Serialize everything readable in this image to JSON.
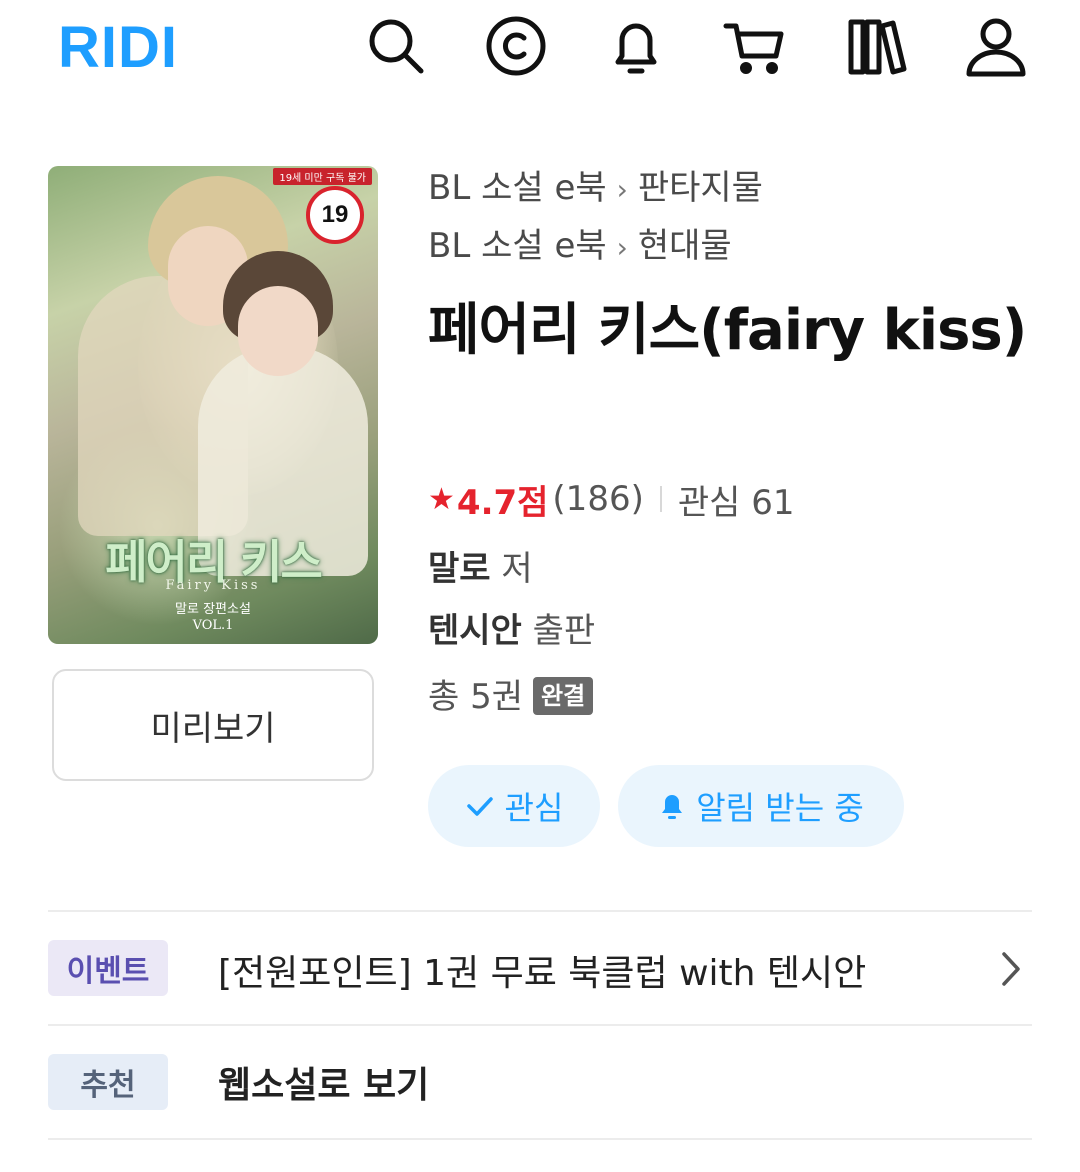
{
  "header": {
    "logo": "RIDI",
    "icons": [
      "search-icon",
      "cash-icon",
      "bell-icon",
      "cart-icon",
      "library-icon",
      "user-icon"
    ],
    "logo_color": "#1e9eff"
  },
  "book": {
    "cover": {
      "age_strip": "19세 미만 구독 불가",
      "age_badge": "19",
      "title": "페어리 키스",
      "title_en": "Fairy Kiss",
      "subtitle": "말로 장편소설",
      "volume": "VOL.1"
    },
    "preview_label": "미리보기",
    "categories": [
      {
        "main": "BL 소설 e북",
        "sub": "판타지물"
      },
      {
        "main": "BL 소설 e북",
        "sub": "현대물"
      }
    ],
    "title": "페어리 키스(fairy kiss)",
    "rating": {
      "score": "4.7점",
      "count": "(186)",
      "interest": "관심 61"
    },
    "author": {
      "name": "말로",
      "role": "저"
    },
    "publisher": {
      "name": "텐시안",
      "role": "출판"
    },
    "volumes": {
      "text": "총 5권",
      "status": "완결"
    },
    "buttons": {
      "interest": "관심",
      "notify": "알림 받는 중"
    },
    "accent_color": "#1e9eff",
    "rating_color": "#e5232d"
  },
  "rows": [
    {
      "tag": "이벤트",
      "text": "[전원포인트] 1권 무료 북클럽 with 텐시안"
    },
    {
      "tag": "추천",
      "text": "웹소설로 보기"
    }
  ]
}
